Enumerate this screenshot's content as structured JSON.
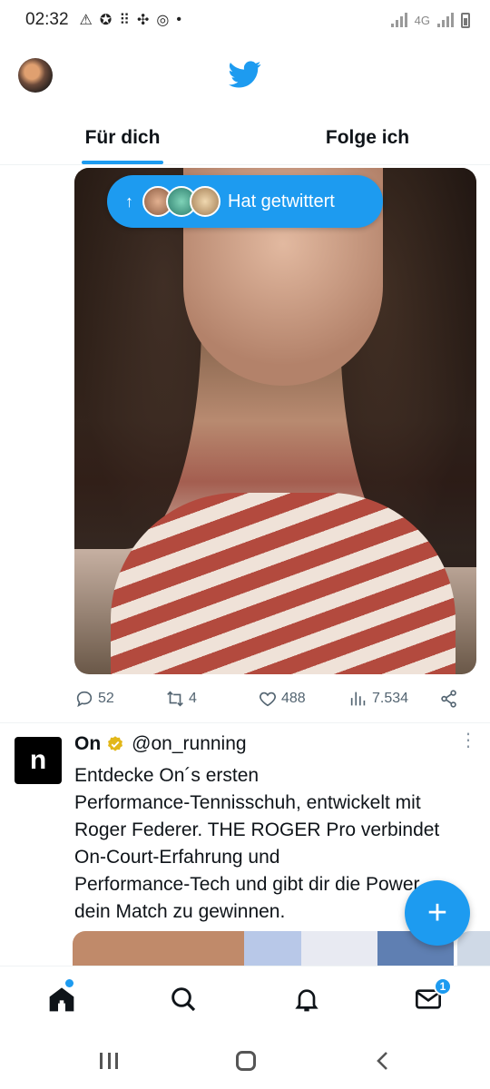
{
  "status_bar": {
    "time": "02:32",
    "network": "4G"
  },
  "tabs": [
    {
      "label": "Für dich",
      "active": true
    },
    {
      "label": "Folge ich",
      "active": false
    }
  ],
  "new_posts_pill": {
    "label": "Hat getwittert",
    "avatars": [
      "#b07b5a",
      "#3aa58a",
      "#c9a77a"
    ]
  },
  "tweet1": {
    "replies": "52",
    "retweets": "4",
    "likes": "488",
    "views": "7.534"
  },
  "tweet2": {
    "avatar_letter": "n",
    "name": "On",
    "handle": "@on_running",
    "text": "Entdecke On´s ersten\nPerformance-Tennisschuh, entwickelt mit\nRoger Federer. THE ROGER Pro verbindet\nOn-Court-Erfahrung und\nPerformance-Tech und gibt dir die Power,\ndein Match zu gewinnen."
  },
  "bottom_nav": {
    "mail_badge": "1"
  },
  "colors": {
    "accent": "#1d9bf0",
    "text": "#0f1419",
    "muted": "#536471",
    "verified": "#e2b719"
  }
}
